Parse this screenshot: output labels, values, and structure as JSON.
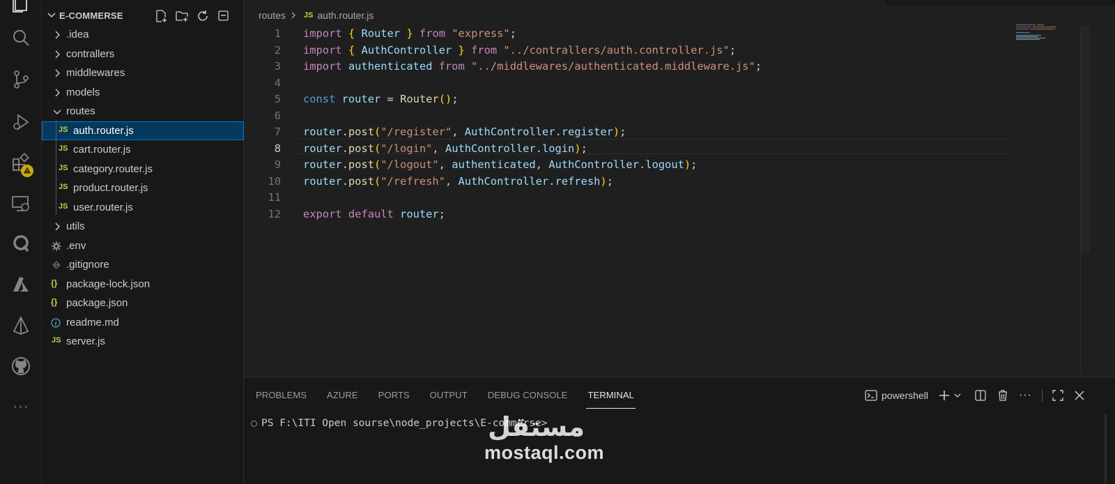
{
  "explorer": {
    "title": "E-COMMERSE",
    "items": [
      {
        "label": ".idea",
        "type": "folder"
      },
      {
        "label": "contrallers",
        "type": "folder"
      },
      {
        "label": "middlewares",
        "type": "folder"
      },
      {
        "label": "models",
        "type": "folder"
      },
      {
        "label": "routes",
        "type": "folder-open"
      },
      {
        "label": "auth.router.js",
        "type": "js",
        "selected": true
      },
      {
        "label": "cart.router.js",
        "type": "js"
      },
      {
        "label": "category.router.js",
        "type": "js"
      },
      {
        "label": "product.router.js",
        "type": "js"
      },
      {
        "label": "user.router.js",
        "type": "js"
      },
      {
        "label": "utils",
        "type": "folder"
      },
      {
        "label": ".env",
        "type": "env"
      },
      {
        "label": ".gitignore",
        "type": "git"
      },
      {
        "label": "package-lock.json",
        "type": "json"
      },
      {
        "label": "package.json",
        "type": "json"
      },
      {
        "label": "readme.md",
        "type": "md"
      },
      {
        "label": "server.js",
        "type": "js"
      }
    ],
    "icon_labels": {
      "js": "JS",
      "json": "{}"
    }
  },
  "breadcrumb": {
    "folder": "routes",
    "file_icon": "JS",
    "file": "auth.router.js"
  },
  "editor": {
    "active_line": 8,
    "lines": [
      {
        "n": "1"
      },
      {
        "n": "2"
      },
      {
        "n": "3"
      },
      {
        "n": "4"
      },
      {
        "n": "5"
      },
      {
        "n": "6"
      },
      {
        "n": "7"
      },
      {
        "n": "8"
      },
      {
        "n": "9"
      },
      {
        "n": "10"
      },
      {
        "n": "11"
      },
      {
        "n": "12"
      }
    ],
    "tokens": {
      "import": "import",
      "from": "from",
      "const": "const",
      "export": "export",
      "default": "default",
      "Router": "Router",
      "AuthController": "AuthController",
      "authenticated": "authenticated",
      "router": "router",
      "post": "post",
      "register": "register",
      "login": "login",
      "logout": "logout",
      "refresh": "refresh",
      "s_express": "\"express\"",
      "s_auth_ctrl": "\"../contrallers/auth.controller.js\"",
      "s_auth_mw": "\"../middlewares/authenticated.middleware.js\"",
      "s_register": "\"/register\"",
      "s_login": "\"/login\"",
      "s_logout": "\"/logout\"",
      "s_refresh": "\"/refresh\""
    }
  },
  "panel": {
    "tabs": [
      "PROBLEMS",
      "AZURE",
      "PORTS",
      "OUTPUT",
      "DEBUG CONSOLE",
      "TERMINAL"
    ],
    "active_tab": "TERMINAL",
    "shell_label": "powershell",
    "terminal_prompt": "PS F:\\ITI Open sourse\\node_projects\\E-commerse>"
  },
  "watermark": {
    "arabic": "مستقل",
    "latin": "mostaql.com"
  },
  "colors": {
    "keyword": "#c586c0",
    "keyword_blue": "#569cd6",
    "variable": "#9cdcfe",
    "class": "#4ec9b0",
    "function": "#dcdcaa",
    "string": "#ce9178",
    "js_icon": "#cbcb41",
    "selection": "#04395e",
    "focus_border": "#0078d4"
  }
}
